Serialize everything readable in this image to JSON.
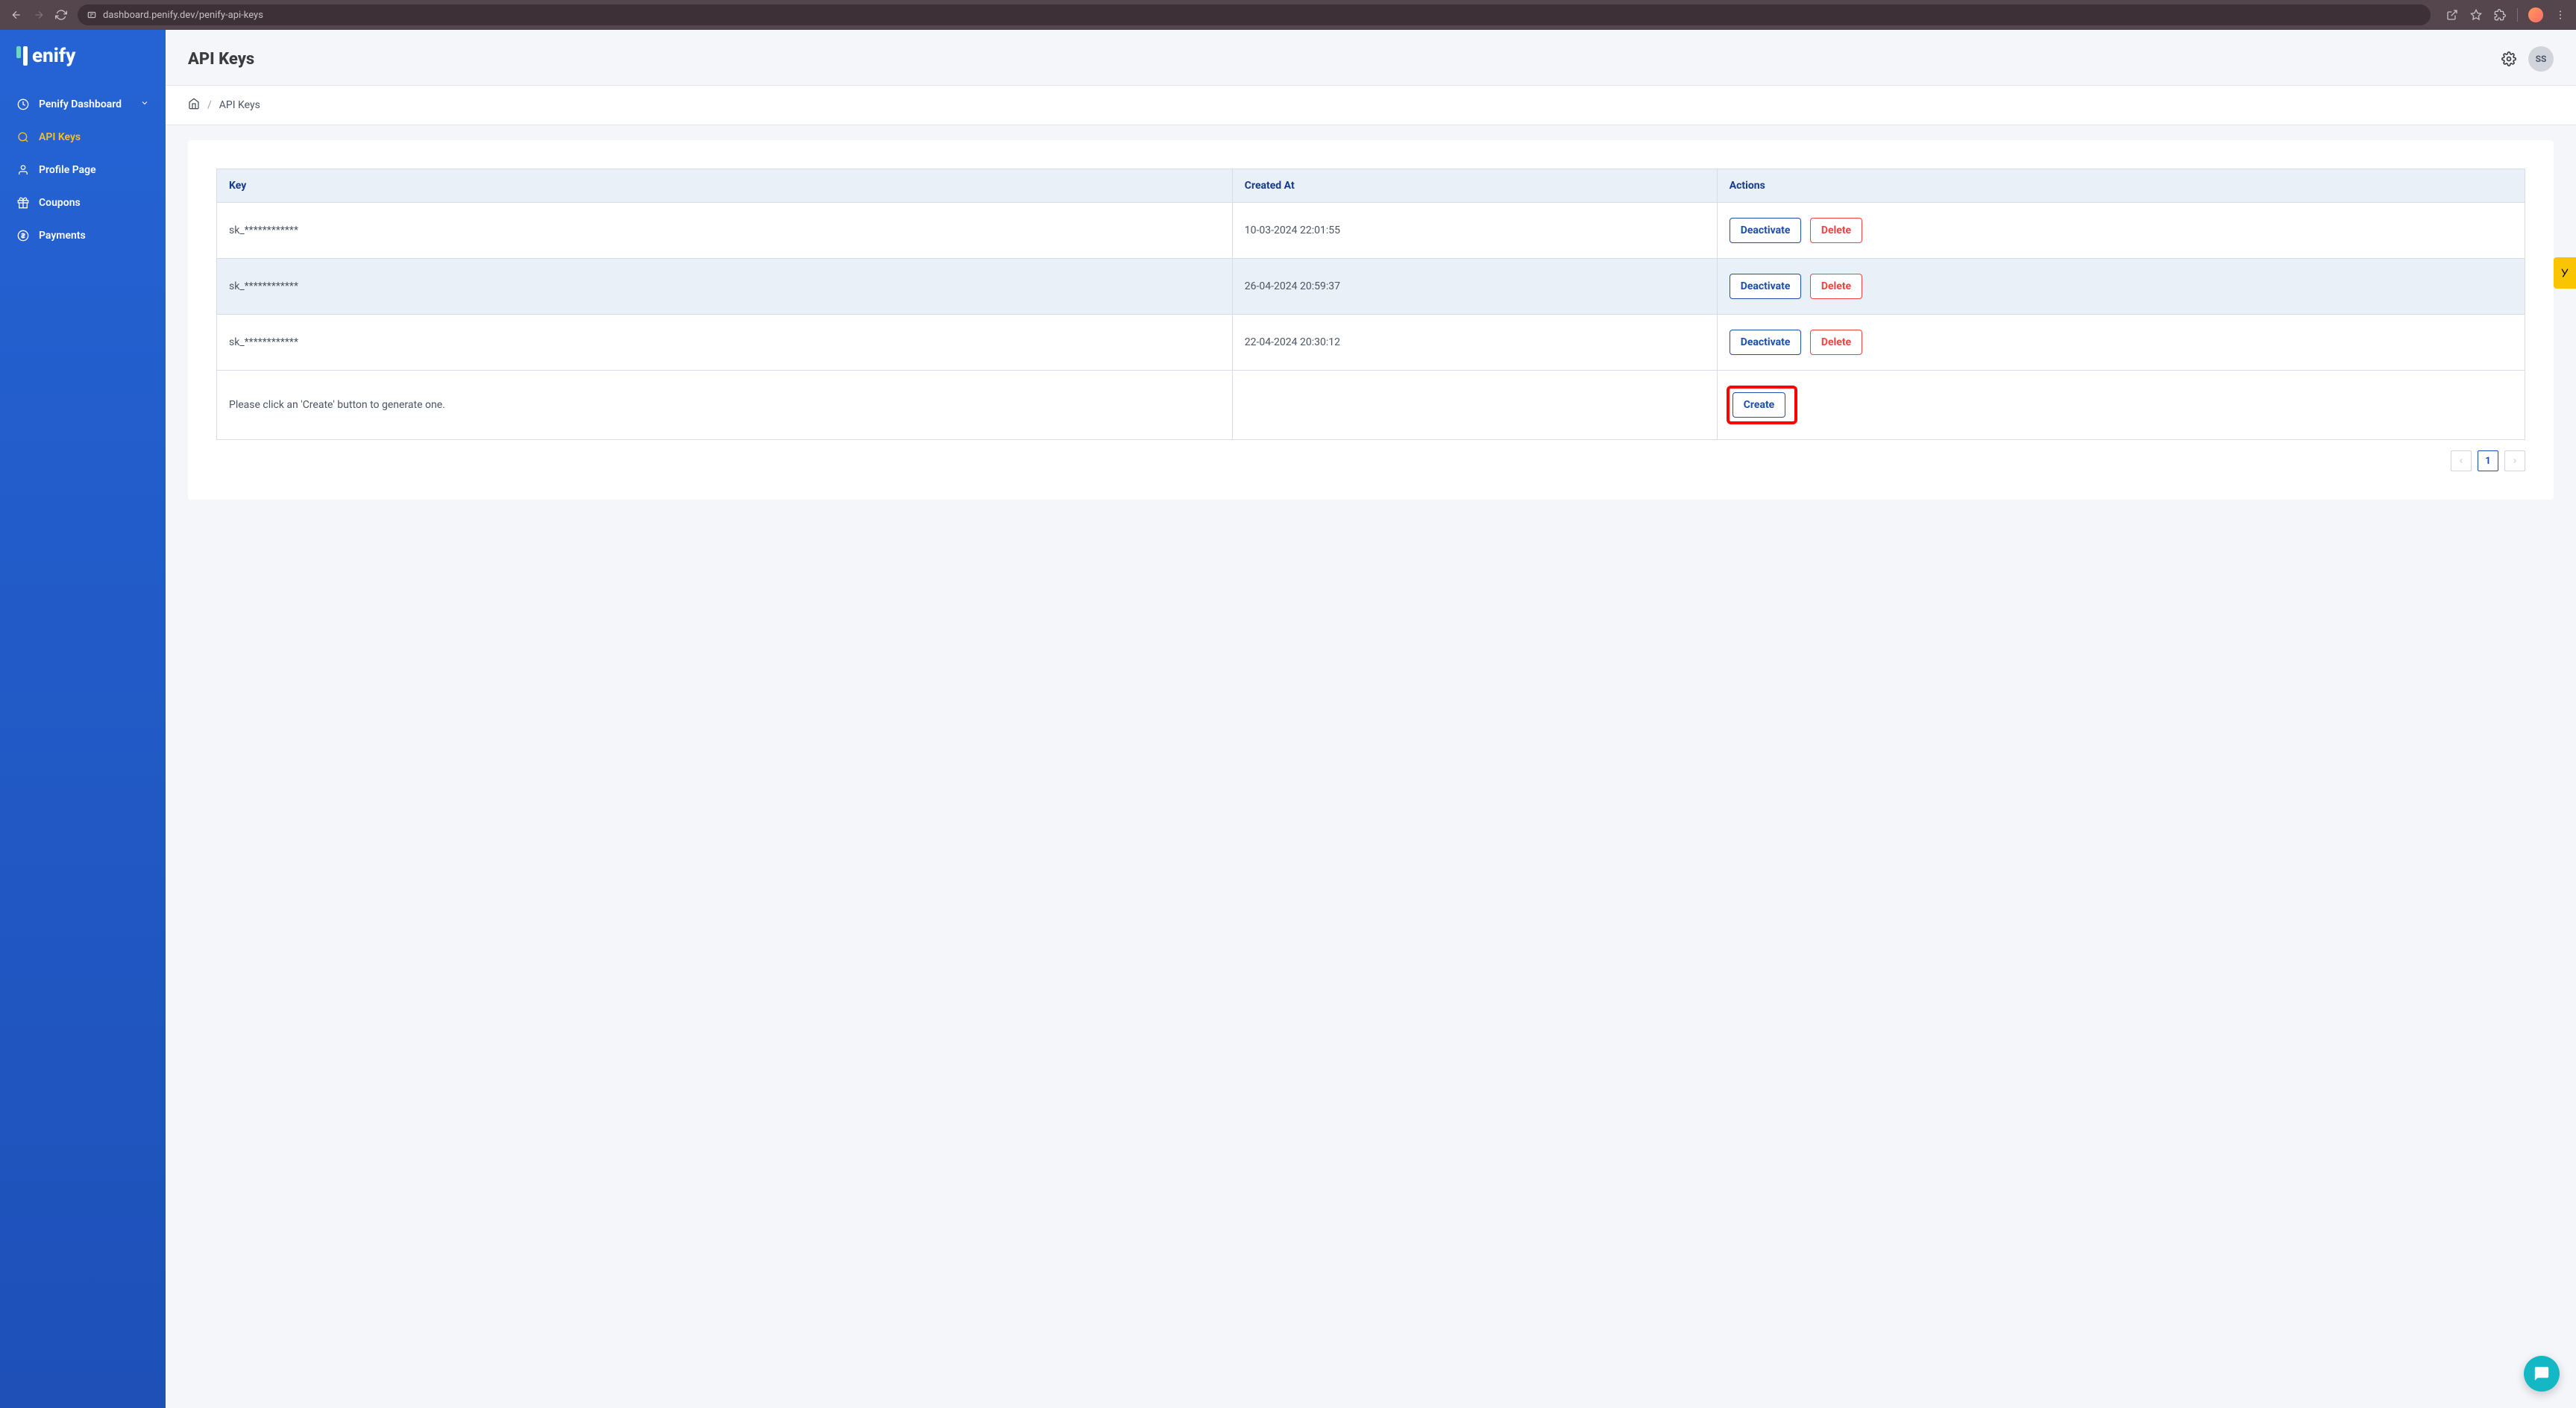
{
  "browser": {
    "url": "dashboard.penify.dev/penify-api-keys"
  },
  "logo": {
    "text": "enify"
  },
  "sidebar": {
    "items": [
      {
        "label": "Penify Dashboard",
        "icon": "dashboard-icon",
        "active": false,
        "hasChevron": true
      },
      {
        "label": "API Keys",
        "icon": "search-icon",
        "active": true
      },
      {
        "label": "Profile Page",
        "icon": "person-icon",
        "active": false
      },
      {
        "label": "Coupons",
        "icon": "gift-icon",
        "active": false
      },
      {
        "label": "Payments",
        "icon": "dollar-icon",
        "active": false
      }
    ]
  },
  "header": {
    "title": "API Keys",
    "avatar": "SS"
  },
  "breadcrumb": {
    "current": "API Keys"
  },
  "table": {
    "headers": {
      "key": "Key",
      "created": "Created At",
      "actions": "Actions"
    },
    "rows": [
      {
        "key": "sk_************",
        "created": "10-03-2024 22:01:55"
      },
      {
        "key": "sk_************",
        "created": "26-04-2024 20:59:37"
      },
      {
        "key": "sk_************",
        "created": "22-04-2024 20:30:12"
      }
    ],
    "footerText": "Please click an 'Create' button to generate one.",
    "buttons": {
      "deactivate": "Deactivate",
      "delete": "Delete",
      "create": "Create"
    }
  },
  "pagination": {
    "current": "1"
  }
}
